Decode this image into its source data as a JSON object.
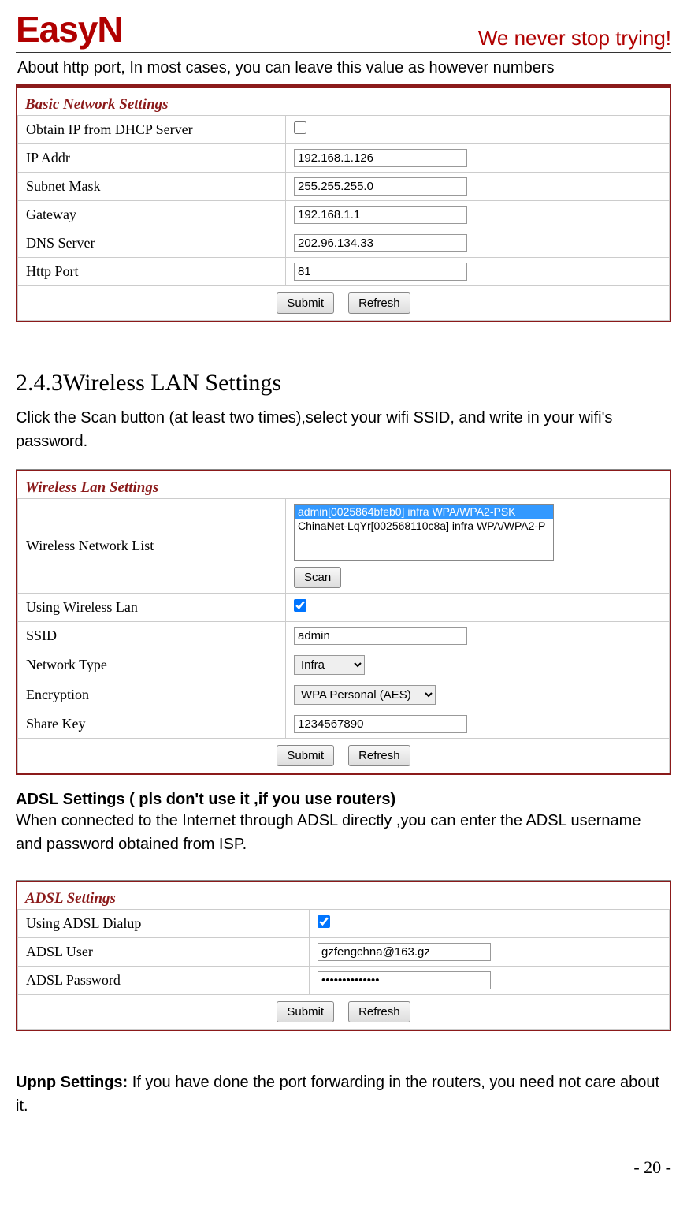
{
  "header": {
    "logo": "EasyN",
    "slogan": "We never stop trying!"
  },
  "intro": "About http port, In most cases, you can leave this value as however numbers",
  "basic_network": {
    "title": "Basic Network Settings",
    "rows": {
      "dhcp_label": "Obtain IP from DHCP Server",
      "ip_label": "IP Addr",
      "ip_value": "192.168.1.126",
      "subnet_label": "Subnet Mask",
      "subnet_value": "255.255.255.0",
      "gateway_label": "Gateway",
      "gateway_value": "192.168.1.1",
      "dns_label": "DNS Server",
      "dns_value": "202.96.134.33",
      "http_label": "Http Port",
      "http_value": "81"
    },
    "submit_label": "Submit",
    "refresh_label": "Refresh"
  },
  "wireless_section": {
    "heading": "2.4.3Wireless LAN Settings",
    "desc": "Click the Scan button (at least two times),select your wifi SSID, and write in your wifi's password."
  },
  "wireless_lan": {
    "title": "Wireless Lan Settings",
    "list_label": "Wireless Network List",
    "list_selected": "admin[0025864bfeb0] infra WPA/WPA2-PSK",
    "list_item2": "ChinaNet-LqYr[002568110c8a] infra WPA/WPA2-P",
    "scan_label": "Scan",
    "using_label": "Using Wireless Lan",
    "ssid_label": "SSID",
    "ssid_value": "admin",
    "network_type_label": "Network Type",
    "network_type_value": "Infra",
    "encryption_label": "Encryption",
    "encryption_value": "WPA Personal (AES)",
    "sharekey_label": "Share Key",
    "sharekey_value": "1234567890",
    "submit_label": "Submit",
    "refresh_label": "Refresh"
  },
  "adsl_section": {
    "heading": "ADSL Settings ( pls don't use it ,if you use routers)",
    "desc": "When connected to the Internet through ADSL directly ,you can enter the ADSL username and password obtained from ISP."
  },
  "adsl": {
    "title": "ADSL Settings",
    "using_label": "Using ADSL Dialup",
    "user_label": "ADSL User",
    "user_value": "gzfengchna@163.gz",
    "password_label": "ADSL Password",
    "password_value": "••••••••••••••",
    "submit_label": "Submit",
    "refresh_label": "Refresh"
  },
  "upnp": {
    "label": "Upnp Settings: ",
    "text": "If you have done the port forwarding in the routers, you need not care about it."
  },
  "page_number": "- 20 -"
}
